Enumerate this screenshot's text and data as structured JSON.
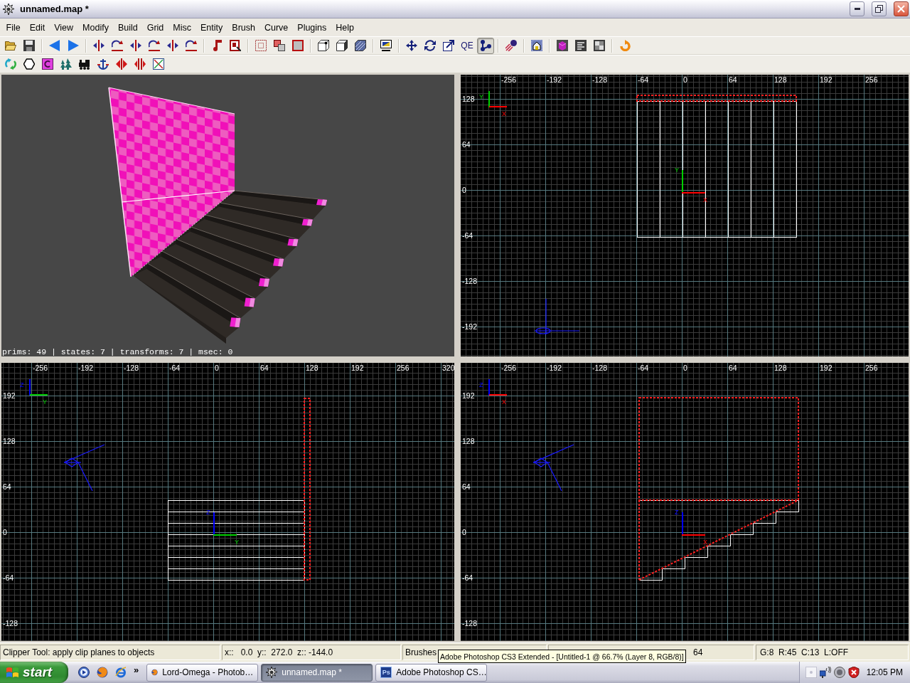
{
  "window": {
    "title": "unnamed.map *"
  },
  "menu": [
    "File",
    "Edit",
    "View",
    "Modify",
    "Build",
    "Grid",
    "Misc",
    "Entity",
    "Brush",
    "Curve",
    "Plugins",
    "Help"
  ],
  "toolbars": [
    {
      "groups": [
        [
          {
            "pressed": false
          },
          {
            "pressed": false
          }
        ],
        [
          {
            "pressed": false
          },
          {
            "pressed": false
          }
        ],
        [
          {
            "pressed": false
          },
          {
            "pressed": false
          },
          {
            "pressed": false
          },
          {
            "pressed": false
          },
          {
            "pressed": false
          },
          {
            "pressed": false
          }
        ],
        [
          {
            "pressed": false
          },
          {
            "pressed": false
          }
        ],
        [
          {
            "pressed": false
          },
          {
            "pressed": false
          },
          {
            "pressed": false
          }
        ],
        [
          {
            "pressed": false
          },
          {
            "pressed": false
          },
          {
            "pressed": false
          }
        ],
        [
          {
            "pressed": false
          }
        ],
        [
          {
            "pressed": false
          },
          {
            "pressed": false
          },
          {
            "pressed": false
          },
          {
            "label": "QE",
            "pressed": false
          },
          {
            "pressed": true
          }
        ],
        [
          {
            "pressed": false
          }
        ],
        [
          {
            "pressed": false
          }
        ],
        [
          {
            "pressed": false
          },
          {
            "pressed": false
          },
          {
            "pressed": false
          }
        ],
        [
          {
            "pressed": false
          }
        ]
      ]
    },
    {
      "groups": [
        [
          {
            "pressed": false
          },
          {
            "pressed": false
          },
          {
            "pressed": false
          },
          {
            "pressed": false
          },
          {
            "pressed": false
          },
          {
            "pressed": false
          },
          {
            "pressed": false
          },
          {
            "pressed": false
          },
          {
            "pressed": false
          }
        ]
      ]
    }
  ],
  "camera_view": {
    "stats": "prims: 49 | states: 7 | transforms: 7 | msec: 0"
  },
  "grid_views": [
    {
      "kind": "top",
      "x_labels": [
        "-256",
        "-192",
        "-128",
        "-64",
        "0",
        "64",
        "128",
        "192",
        "256"
      ],
      "y_labels": [
        "128",
        "64",
        "0",
        "-64",
        "-128",
        "-192"
      ],
      "corner_axes": [
        {
          "label": "Y",
          "color": "#00d000"
        },
        {
          "label": "X",
          "color": "#ff0000"
        }
      ],
      "origin_axes": [
        {
          "label": "Y",
          "color": "#00d000"
        },
        {
          "label": "X",
          "color": "#ff0000"
        }
      ]
    },
    {
      "kind": "side",
      "x_labels": [
        "-256",
        "-192",
        "-128",
        "-64",
        "0",
        "64",
        "128",
        "192",
        "256",
        "320"
      ],
      "y_labels": [
        "192",
        "128",
        "64",
        "0",
        "-64",
        "-128"
      ],
      "corner_axes": [
        {
          "label": "Z",
          "color": "#0000ff"
        },
        {
          "label": "Y",
          "color": "#00d000"
        }
      ],
      "origin_axes": [
        {
          "label": "Z",
          "color": "#0000ff"
        },
        {
          "label": "Y",
          "color": "#00d000"
        }
      ]
    },
    {
      "kind": "front",
      "x_labels": [
        "-256",
        "-192",
        "-128",
        "-64",
        "0",
        "64",
        "128",
        "192",
        "256"
      ],
      "y_labels": [
        "192",
        "128",
        "64",
        "0",
        "-64",
        "-128"
      ],
      "corner_axes": [
        {
          "label": "Z",
          "color": "#0000ff"
        },
        {
          "label": "X",
          "color": "#ff0000"
        }
      ],
      "origin_axes": [
        {
          "label": "Z",
          "color": "#0000ff"
        },
        {
          "label": "X",
          "color": "#ff0000"
        }
      ]
    }
  ],
  "status_bar": [
    "Clipper Tool: apply clip planes to objects",
    "x::   0.0  y::  272.0  z:: -144.0",
    "Brushes",
    "64",
    "G:8  R:45  C:13  L:OFF"
  ],
  "tooltip": "Adobe Photoshop CS3 Extended - [Untitled-1 @ 66.7% (Layer 8, RGB/8)]",
  "taskbar": {
    "start": "start",
    "overflow": "»",
    "tasks": [
      {
        "label": "Lord-Omega - Photob…",
        "selected": false
      },
      {
        "label": "unnamed.map *",
        "selected": true
      },
      {
        "label": "Adobe Photoshop CS…",
        "badge": "Ps",
        "selected": false
      }
    ],
    "clock": "12:05 PM"
  }
}
